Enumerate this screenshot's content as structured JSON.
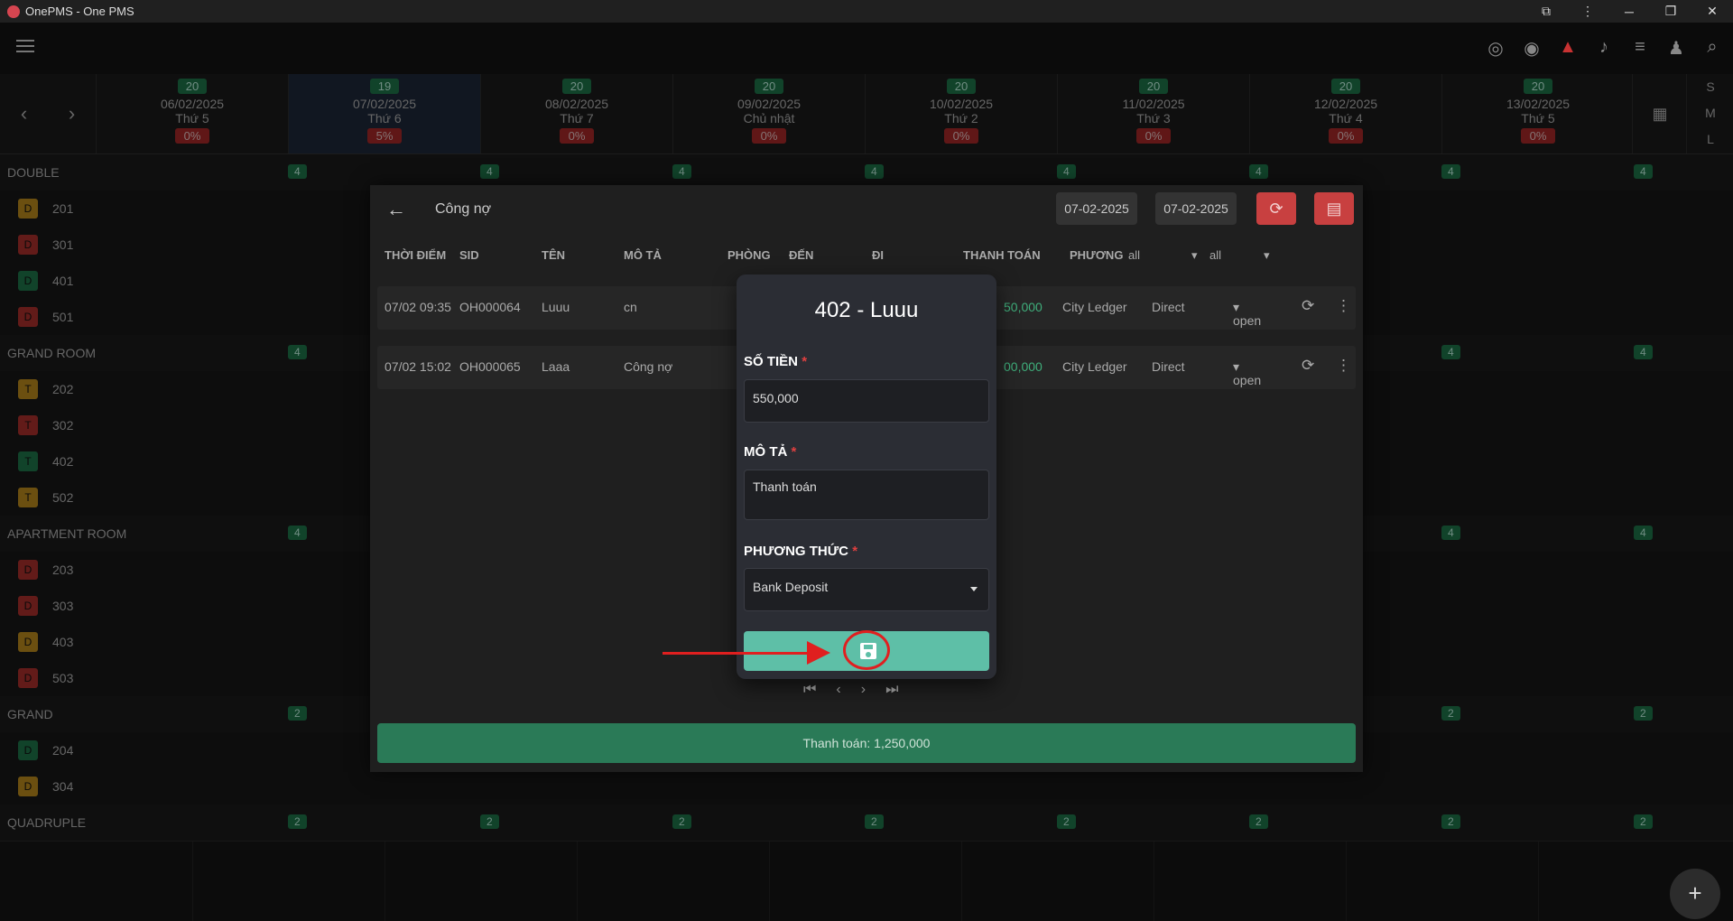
{
  "window": {
    "title": "OnePMS - One PMS",
    "controls": [
      "⧉",
      "⋮",
      "─",
      "❐",
      "✕"
    ]
  },
  "appbar": {
    "icons": [
      "radio-icon",
      "eye-icon",
      "warning-icon",
      "bell-icon",
      "list-icon",
      "add-user-icon",
      "search-icon"
    ]
  },
  "datebar": {
    "days": [
      {
        "count": "20",
        "date": "06/02/2025",
        "weekday": "Thứ 5",
        "pct": "0%"
      },
      {
        "count": "19",
        "date": "07/02/2025",
        "weekday": "Thứ 6",
        "pct": "5%"
      },
      {
        "count": "20",
        "date": "08/02/2025",
        "weekday": "Thứ 7",
        "pct": "0%"
      },
      {
        "count": "20",
        "date": "09/02/2025",
        "weekday": "Chủ nhật",
        "pct": "0%"
      },
      {
        "count": "20",
        "date": "10/02/2025",
        "weekday": "Thứ 2",
        "pct": "0%"
      },
      {
        "count": "20",
        "date": "11/02/2025",
        "weekday": "Thứ 3",
        "pct": "0%"
      },
      {
        "count": "20",
        "date": "12/02/2025",
        "weekday": "Thứ 4",
        "pct": "0%"
      },
      {
        "count": "20",
        "date": "13/02/2025",
        "weekday": "Thứ 5",
        "pct": "0%"
      }
    ],
    "sizes": [
      "S",
      "M",
      "L"
    ]
  },
  "rooms": {
    "groups": [
      {
        "name": "DOUBLE",
        "count": "4",
        "rooms": [
          [
            "D",
            "201",
            "yellow"
          ],
          [
            "D",
            "301",
            "red"
          ],
          [
            "D",
            "401",
            "green"
          ],
          [
            "D",
            "501",
            "red"
          ]
        ]
      },
      {
        "name": "GRAND ROOM",
        "count": "4",
        "rooms": [
          [
            "T",
            "202",
            "yellow"
          ],
          [
            "T",
            "302",
            "red"
          ],
          [
            "T",
            "402",
            "green"
          ],
          [
            "T",
            "502",
            "yellow"
          ]
        ]
      },
      {
        "name": "APARTMENT ROOM",
        "count": "4",
        "rooms": [
          [
            "D",
            "203",
            "red"
          ],
          [
            "D",
            "303",
            "red"
          ],
          [
            "D",
            "403",
            "yellow"
          ],
          [
            "D",
            "503",
            "red"
          ]
        ]
      },
      {
        "name": "GRAND",
        "count": "2",
        "rooms": [
          [
            "D",
            "204",
            "green"
          ],
          [
            "D",
            "304",
            "yellow"
          ]
        ]
      },
      {
        "name": "QUADRUPLE",
        "count": "2",
        "rooms": []
      }
    ]
  },
  "ledger": {
    "title": "Công nợ",
    "date_from": "07-02-2025",
    "date_to": "07-02-2025",
    "columns": [
      "THỜI ĐIỂM",
      "SID",
      "TÊN",
      "MÔ TẢ",
      "PHÒNG",
      "ĐẾN",
      "ĐI",
      "THANH TOÁN",
      "PHƯƠNG"
    ],
    "filter1": "all",
    "filter2": "all",
    "rows": [
      {
        "time": "07/02 09:35",
        "sid": "OH000064",
        "name": "Luuu",
        "desc": "cn",
        "amount": "50,000",
        "method": "City Ledger",
        "source": "Direct",
        "status": "open"
      },
      {
        "time": "07/02 15:02",
        "sid": "OH000065",
        "name": "Laaa",
        "desc": "Công nợ",
        "amount": "00,000",
        "method": "City Ledger",
        "source": "Direct",
        "status": "open"
      }
    ],
    "total": "Thanh toán: 1,250,000"
  },
  "payment_modal": {
    "title": "402 - Luuu",
    "amount_label": "SỐ TIỀN",
    "amount_value": "550,000",
    "desc_label": "MÔ TẢ",
    "desc_value": "Thanh toán",
    "method_label": "PHƯƠNG THỨC",
    "method_value": "Bank Deposit",
    "required_mark": "*"
  }
}
